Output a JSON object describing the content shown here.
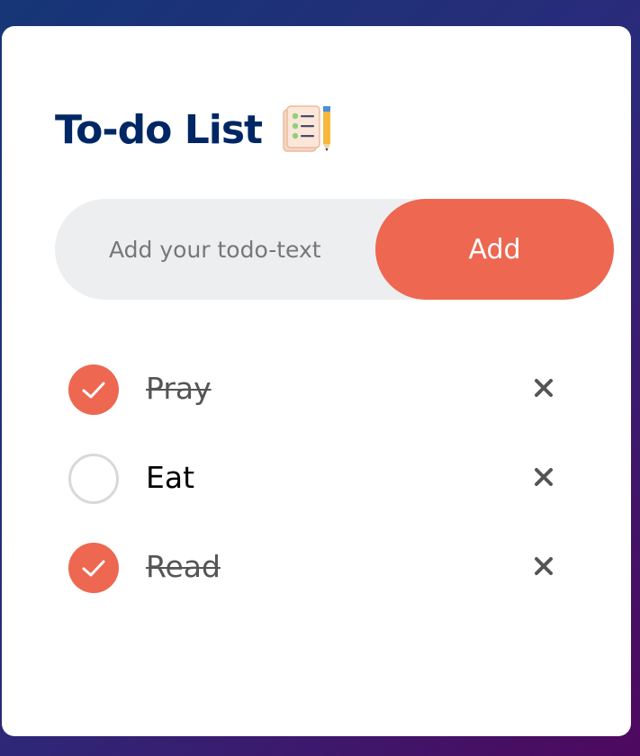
{
  "app": {
    "title": "To-do List",
    "title_icon": "checklist-notepad-with-pencil-icon"
  },
  "input": {
    "placeholder": "Add your todo-text",
    "value": ""
  },
  "add_button": {
    "label": "Add"
  },
  "todos": [
    {
      "text": "Pray",
      "done": true
    },
    {
      "text": "Eat",
      "done": false
    },
    {
      "text": "Read",
      "done": true
    }
  ],
  "icons": {
    "check": "check-icon",
    "remove": "close-icon"
  },
  "colors": {
    "accent": "#ed6751",
    "title": "#002765",
    "input_bg": "#edeef0",
    "unchecked_border": "#d8d8d8",
    "completed_text": "#555555"
  }
}
